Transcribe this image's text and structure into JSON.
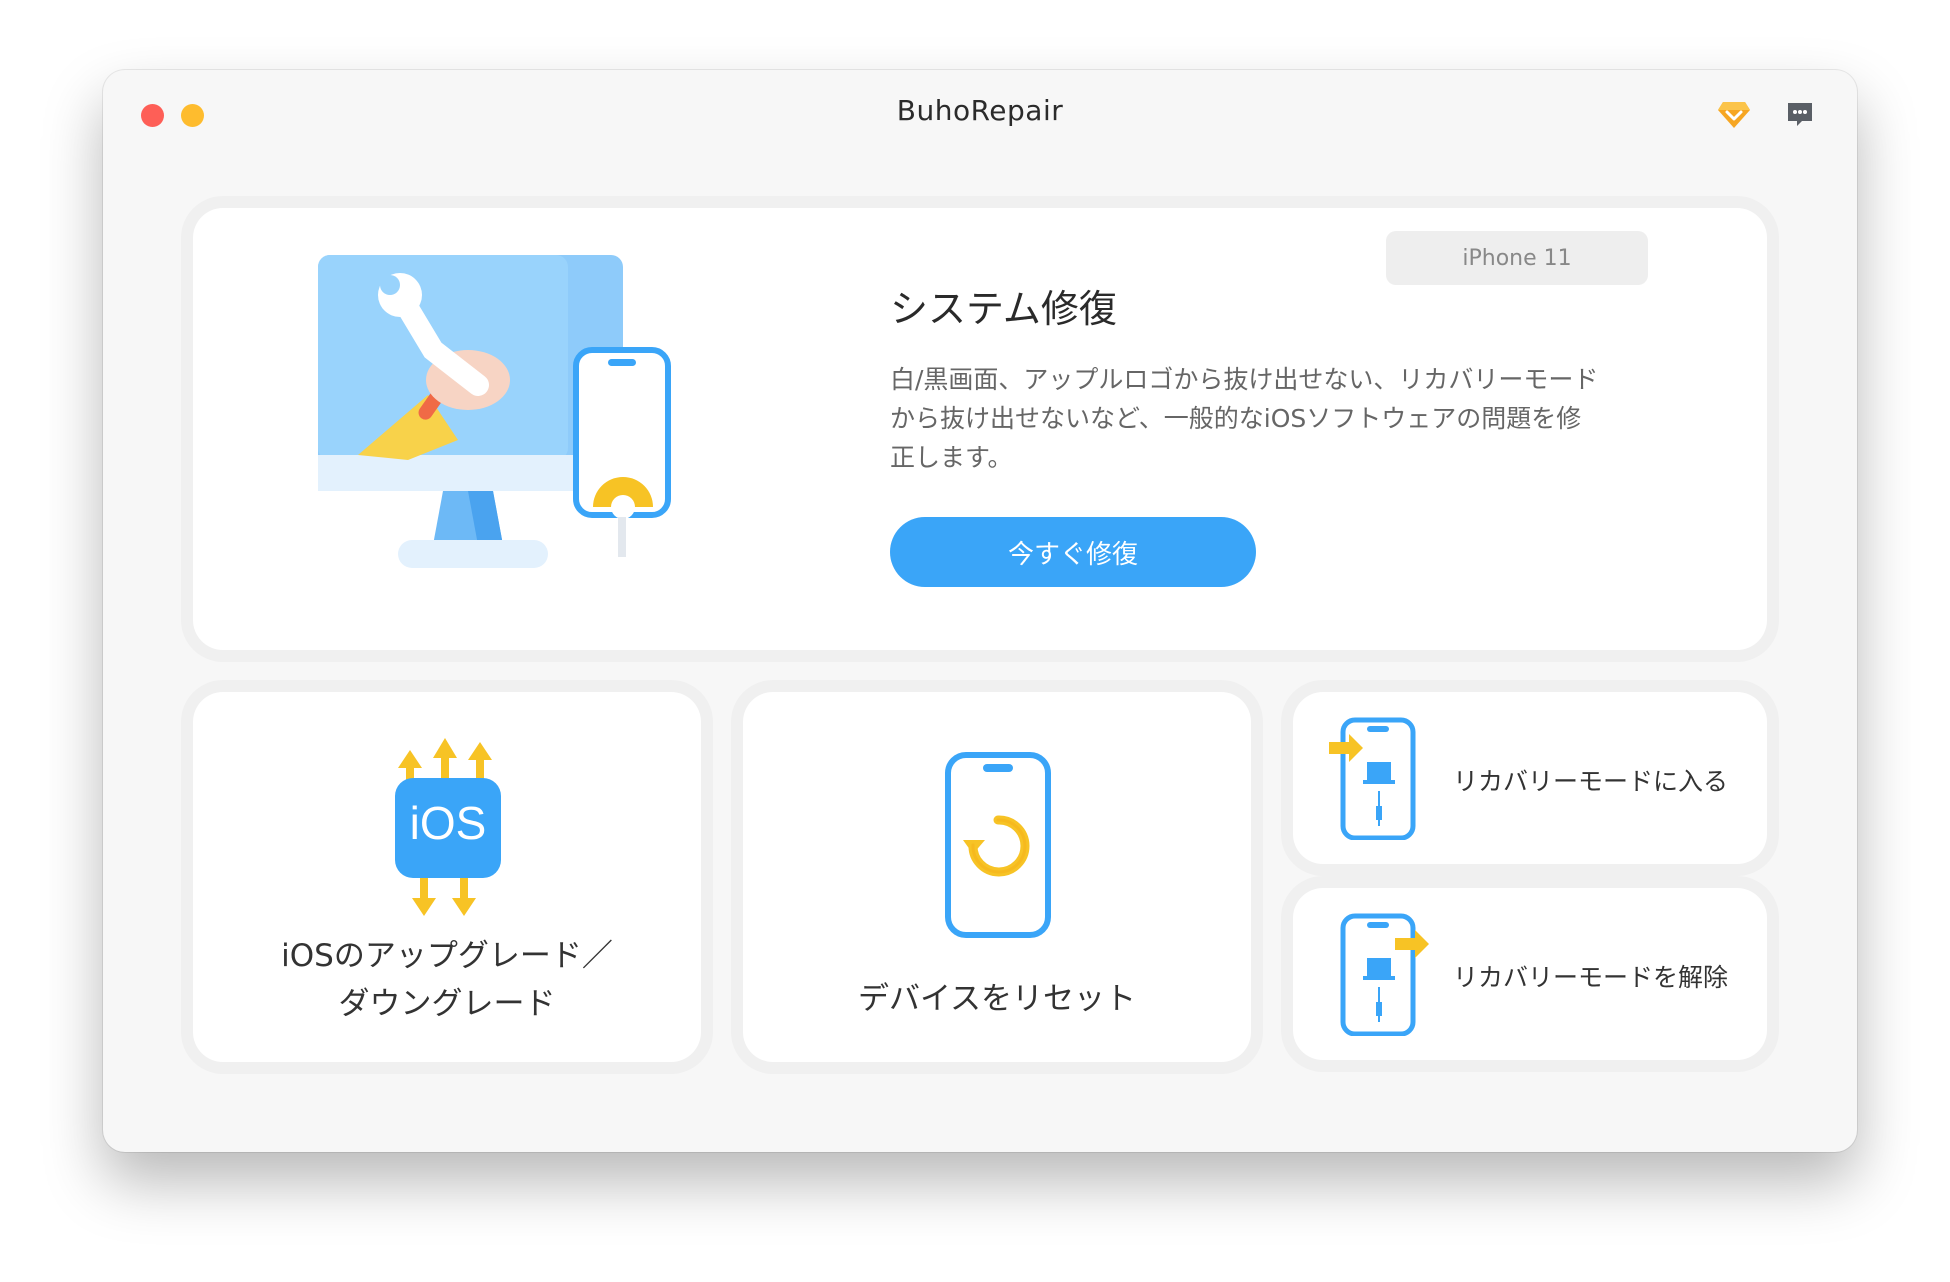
{
  "window": {
    "title": "BuhoRepair"
  },
  "titlebar": {
    "icons": [
      "premium-gem-icon",
      "feedback-chat-icon"
    ]
  },
  "hero": {
    "device": "iPhone 11",
    "title": "システム修復",
    "description": "白/黒画面、アップルロゴから抜け出せない、リカバリーモードから抜け出せないなど、一般的なiOSソフトウェアの問題を修正します。",
    "button_label": "今すぐ修復",
    "illustration": "monitor-wrench-phone-gear"
  },
  "tiles": {
    "ios_upgrade": {
      "label_line1": "iOSのアップグレード／",
      "label_line2": "ダウングレード",
      "icon_text": "iOS"
    },
    "reset_device": {
      "label": "デバイスをリセット"
    },
    "enter_recovery": {
      "label": "リカバリーモードに入る"
    },
    "exit_recovery": {
      "label": "リカバリーモードを解除"
    }
  },
  "colors": {
    "accent": "#3aa5f8",
    "yellow": "#f7c325",
    "window_bg": "#f7f7f7",
    "card_bg": "#ffffff"
  }
}
